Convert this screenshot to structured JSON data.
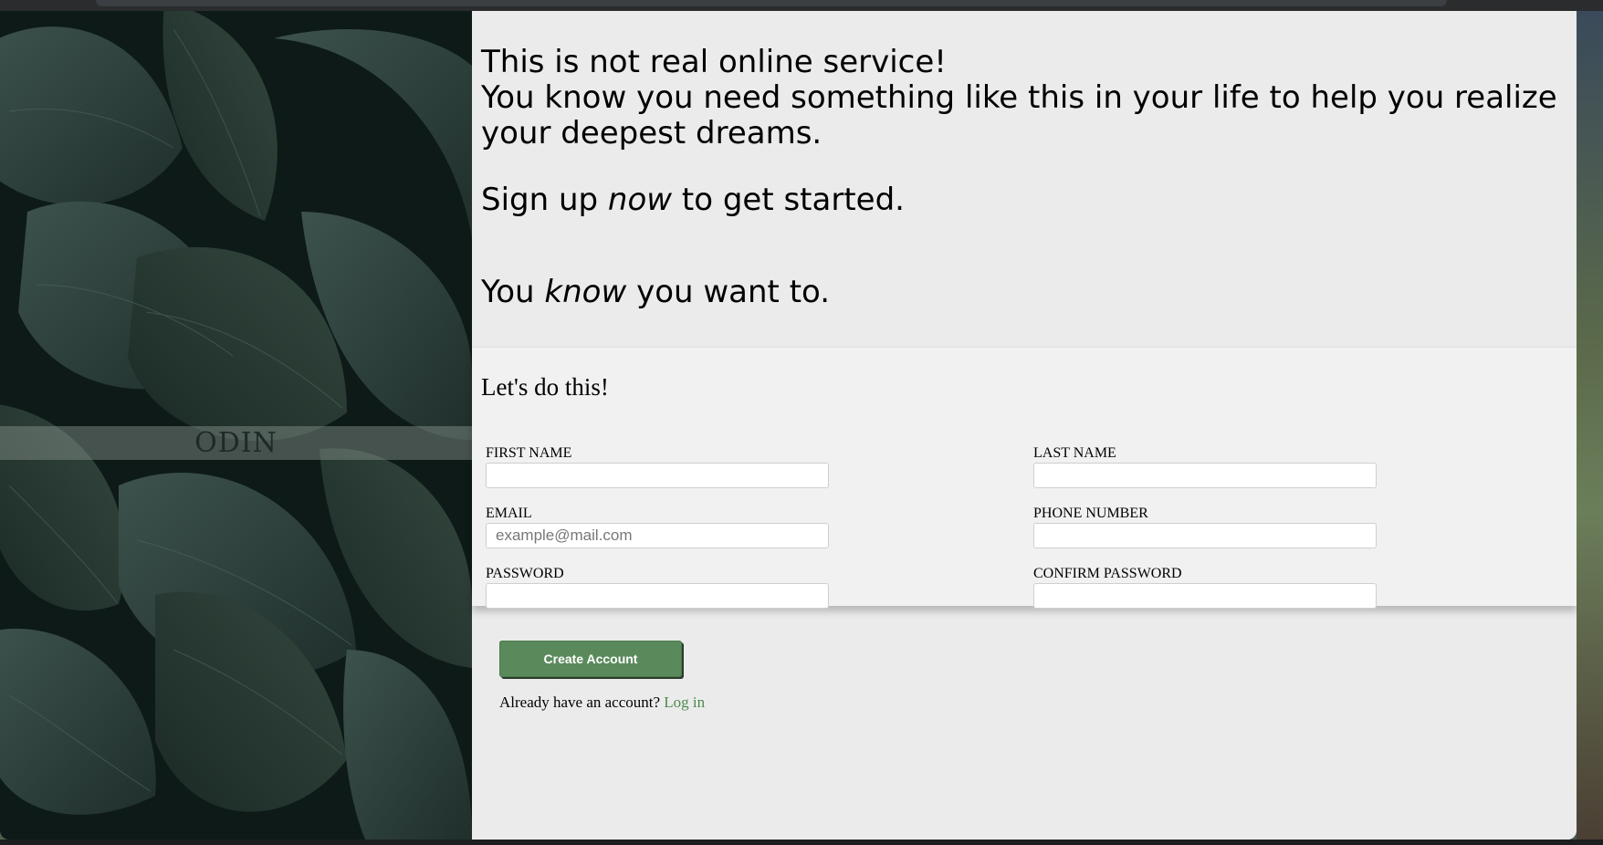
{
  "hero": {
    "logo_text": "ODIN"
  },
  "intro": {
    "line1": "This is not real online service!",
    "line2": "You know you need something like this in your life to help you realize your deepest dreams.",
    "line3_prefix": "Sign up ",
    "line3_emphasis": "now",
    "line3_suffix": " to get started.",
    "line4_prefix": "You ",
    "line4_emphasis": "know",
    "line4_suffix": " you want to."
  },
  "form": {
    "title": "Let's do this!",
    "fields": {
      "first_name": {
        "label": "First Name",
        "value": "",
        "placeholder": ""
      },
      "last_name": {
        "label": "Last Name",
        "value": "",
        "placeholder": ""
      },
      "email": {
        "label": "Email",
        "value": "",
        "placeholder": "example@mail.com"
      },
      "phone": {
        "label": "Phone Number",
        "value": "",
        "placeholder": ""
      },
      "password": {
        "label": "Password",
        "value": "",
        "placeholder": ""
      },
      "confirm_password": {
        "label": "Confirm Password",
        "value": "",
        "placeholder": ""
      }
    }
  },
  "actions": {
    "create_account_label": "Create Account",
    "login_prompt": "Already have an account?",
    "login_link": "Log in"
  },
  "colors": {
    "accent": "#5a8a5c",
    "link": "#4e8a50",
    "panel_background": "#ebebeb",
    "form_background": "#f1f1f1"
  },
  "icons": {
    "hero_background": "leaves-image"
  }
}
